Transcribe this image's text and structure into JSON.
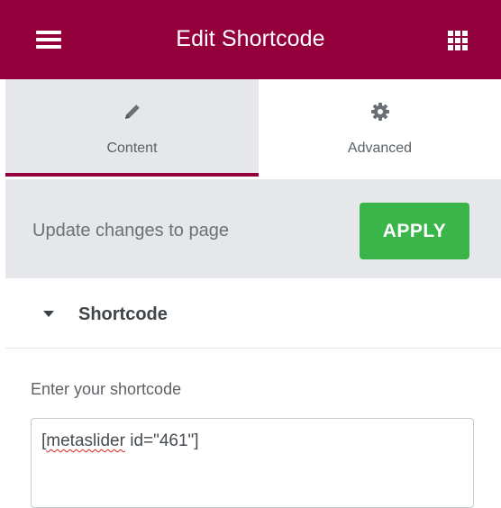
{
  "header": {
    "title": "Edit Shortcode",
    "menu_icon": "hamburger-icon",
    "apps_icon": "grid-icon",
    "background": "#93003c"
  },
  "tabs": [
    {
      "label": "Content",
      "icon": "pencil-icon",
      "active": true
    },
    {
      "label": "Advanced",
      "icon": "gear-icon",
      "active": false
    }
  ],
  "update_bar": {
    "text": "Update changes to page",
    "apply_label": "APPLY",
    "apply_color": "#39b54a"
  },
  "section": {
    "title": "Shortcode",
    "expanded": true
  },
  "shortcode_field": {
    "label": "Enter your shortcode",
    "value_prefix": "[",
    "value_misspelled": "metaslider",
    "value_suffix": " id=\"461\"]"
  }
}
